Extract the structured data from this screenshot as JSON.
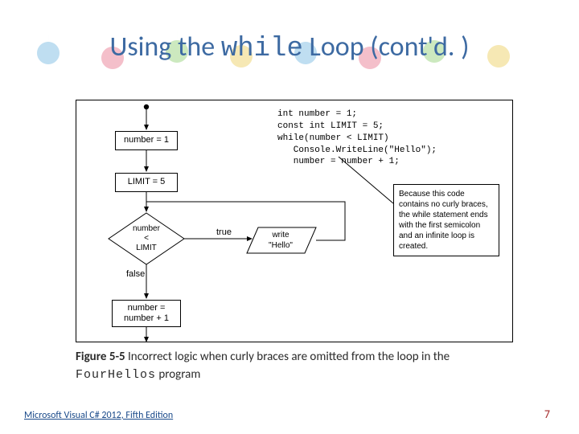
{
  "title": {
    "pre": "Using the ",
    "code": "while",
    "post": " Loop (cont'd. )"
  },
  "code": {
    "l1": "int number = 1;",
    "l2": "const int LIMIT = 5;",
    "l3": "while(number < LIMIT)",
    "l4": "   Console.WriteLine(\"Hello\");",
    "l5": "   number = number + 1;"
  },
  "flow": {
    "box1": "number = 1",
    "box2": "LIMIT = 5",
    "decision_l1": "number",
    "decision_l2": "<",
    "decision_l3": "LIMIT",
    "true": "true",
    "false": "false",
    "write_l1": "write",
    "write_l2": "\"Hello\"",
    "box_last_l1": "number =",
    "box_last_l2": "number + 1"
  },
  "callout": "Because this code contains no curly braces, the while statement ends with the first semicolon and an infinite loop is created.",
  "caption": {
    "fignum": "Figure 5-5",
    "text1": " Incorrect logic when curly braces are omitted from the loop in the ",
    "prog": "FourHellos",
    "text2": " program"
  },
  "footer": {
    "left": "Microsoft Visual C# 2012, Fifth Edition",
    "right": "7"
  }
}
